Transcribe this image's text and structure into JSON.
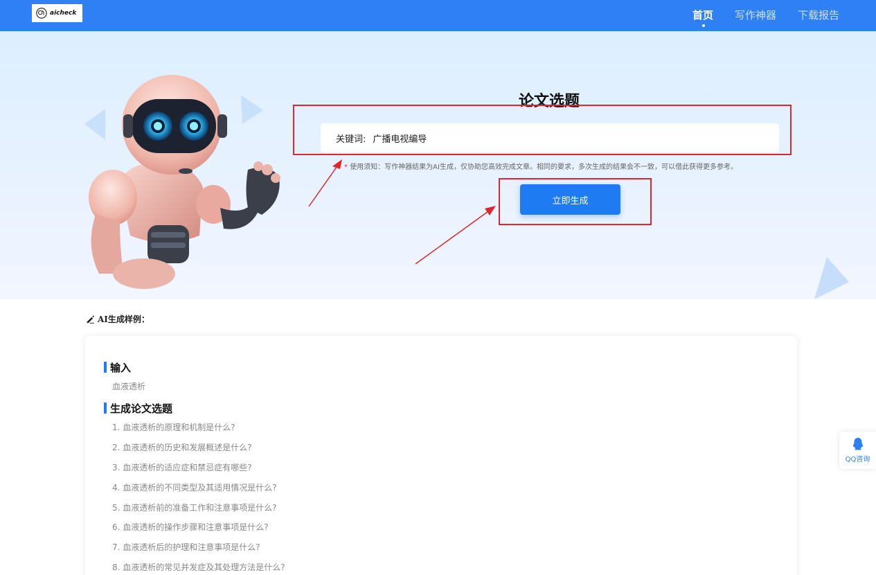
{
  "header": {
    "logo_text": "aicheck",
    "nav": [
      "首页",
      "写作神器",
      "下载报告"
    ]
  },
  "hero": {
    "title": "论文选题",
    "keyword_label": "关键词:",
    "keyword_value": "广播电视编导",
    "notice_star": "*",
    "notice": "使用须知：写作神器结果为AI生成，仅协助您高效完成文章。相同的要求，多次生成的结果会不一致，可以借此获得更多参考。",
    "generate_button": "立即生成"
  },
  "sample": {
    "heading": "AI生成样例：",
    "input_title": "输入",
    "input_text": "血液透析",
    "output_title": "生成论文选题",
    "topics": [
      "1. 血液透析的原理和机制是什么?",
      "2. 血液透析的历史和发展概述是什么?",
      "3. 血液透析的适应症和禁忌症有哪些?",
      "4. 血液透析的不同类型及其适用情况是什么?",
      "5. 血液透析前的准备工作和注意事项是什么?",
      "6. 血液透析的操作步骤和注意事项是什么?",
      "7. 血液透析后的护理和注意事项是什么?",
      "8. 血液透析的常见并发症及其处理方法是什么?"
    ]
  },
  "float": {
    "qq_label": "QQ咨询"
  },
  "colors": {
    "header": "#2f80f5",
    "button": "#1f7bf2",
    "annotation": "#e0262a"
  }
}
